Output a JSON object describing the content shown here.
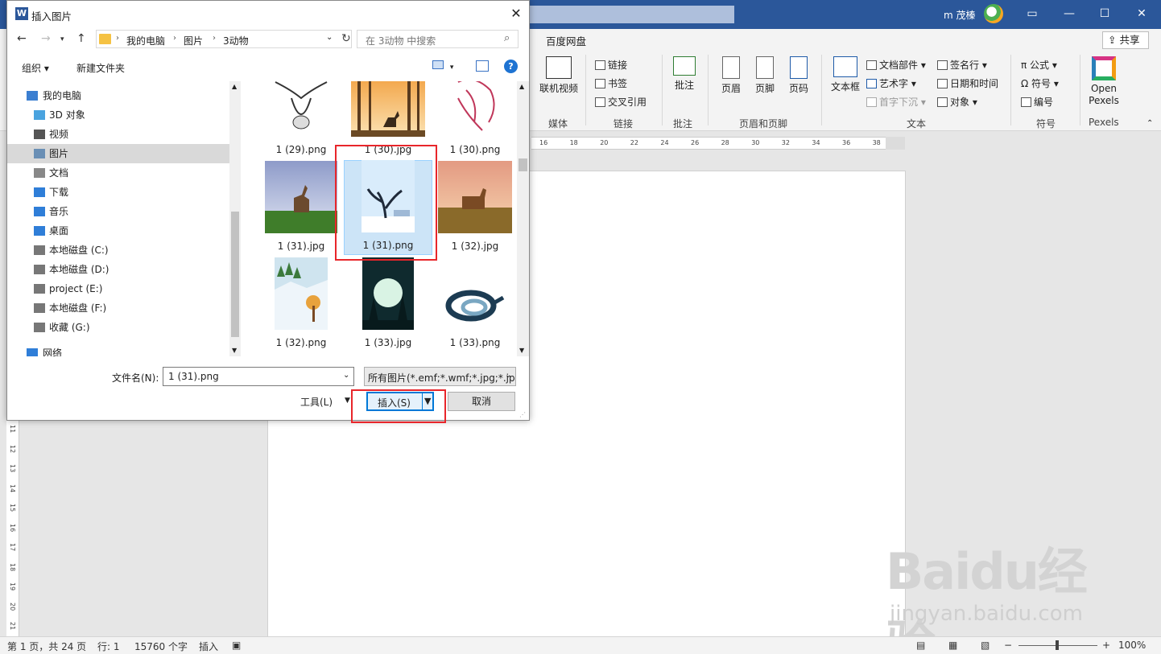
{
  "word": {
    "user_name": "m 茂榛",
    "tab_baidu": "百度网盘",
    "share_label": "共享",
    "ribbon": {
      "online_video": "联机视频",
      "link": "链接",
      "bookmark": "书签",
      "cross_ref": "交叉引用",
      "comment": "批注",
      "header": "页眉",
      "footer": "页脚",
      "page_number": "页码",
      "textbox": "文本框",
      "quick_parts": "文档部件",
      "wordart": "艺术字",
      "dropcap": "首字下沉",
      "signature_line": "签名行",
      "date_time": "日期和时间",
      "object": "对象",
      "equation": "公式",
      "symbol": "符号",
      "number": "编号",
      "open_pexels": "Open Pexels",
      "groups": {
        "media": "媒体",
        "links": "链接",
        "comments": "批注",
        "header_footer": "页眉和页脚",
        "text": "文本",
        "symbols": "符号",
        "pexels": "Pexels"
      }
    },
    "hruler_ticks": [
      "16",
      "18",
      "20",
      "22",
      "24",
      "26",
      "28",
      "30",
      "32",
      "34",
      "36",
      "38"
    ],
    "vruler_ticks": [
      "11",
      "12",
      "13",
      "14",
      "15",
      "16",
      "17",
      "18",
      "19",
      "20",
      "21"
    ],
    "status": {
      "page": "第 1 页，共 24 页",
      "line": "行: 1",
      "words": "15760 个字",
      "mode": "插入",
      "zoom": "100%"
    },
    "watermark": {
      "logo": "Baidu经验",
      "url": "jingyan.baidu.com"
    }
  },
  "dialog": {
    "title": "插入图片",
    "word_icon_letter": "W",
    "breadcrumbs": [
      "我的电脑",
      "图片",
      "3动物"
    ],
    "search_placeholder": "在 3动物 中搜索",
    "organize": "组织 ▾",
    "new_folder": "新建文件夹",
    "help": "?",
    "nav_items": [
      {
        "label": "我的电脑",
        "icon": "computer-icon"
      },
      {
        "label": "3D 对象",
        "icon": "cube-icon"
      },
      {
        "label": "视频",
        "icon": "video-icon"
      },
      {
        "label": "图片",
        "icon": "pictures-icon"
      },
      {
        "label": "文档",
        "icon": "document-icon"
      },
      {
        "label": "下载",
        "icon": "download-icon"
      },
      {
        "label": "音乐",
        "icon": "music-icon"
      },
      {
        "label": "桌面",
        "icon": "desktop-icon"
      },
      {
        "label": "本地磁盘 (C:)",
        "icon": "drive-icon"
      },
      {
        "label": "本地磁盘 (D:)",
        "icon": "drive-icon"
      },
      {
        "label": "project (E:)",
        "icon": "drive-icon"
      },
      {
        "label": "本地磁盘 (F:)",
        "icon": "drive-icon"
      },
      {
        "label": "收藏 (G:)",
        "icon": "drive-icon"
      },
      {
        "label": "网络",
        "icon": "network-icon"
      }
    ],
    "selected_nav": "图片",
    "files": [
      {
        "name": "1 (29).png",
        "picture": "cow-sketch"
      },
      {
        "name": "1 (30).jpg",
        "picture": "deer-forest-sunset"
      },
      {
        "name": "1 (30).png",
        "picture": "horse-line-art"
      },
      {
        "name": "1 (31).jpg",
        "picture": "deer-meadow"
      },
      {
        "name": "1 (31).png",
        "picture": "tree-winter"
      },
      {
        "name": "1 (32).jpg",
        "picture": "deer-field"
      },
      {
        "name": "1 (32).png",
        "picture": "snow-landscape"
      },
      {
        "name": "1 (33).jpg",
        "picture": "moon-forest"
      },
      {
        "name": "1 (33).png",
        "picture": "snake"
      }
    ],
    "selected_file": "1 (31).png",
    "filename_label": "文件名(N):",
    "filename_value": "1 (31).png",
    "filetype_value": "所有图片(*.emf;*.wmf;*.jpg;*.jp",
    "tools_label": "工具(L)",
    "insert_label": "插入(S)",
    "cancel_label": "取消"
  }
}
